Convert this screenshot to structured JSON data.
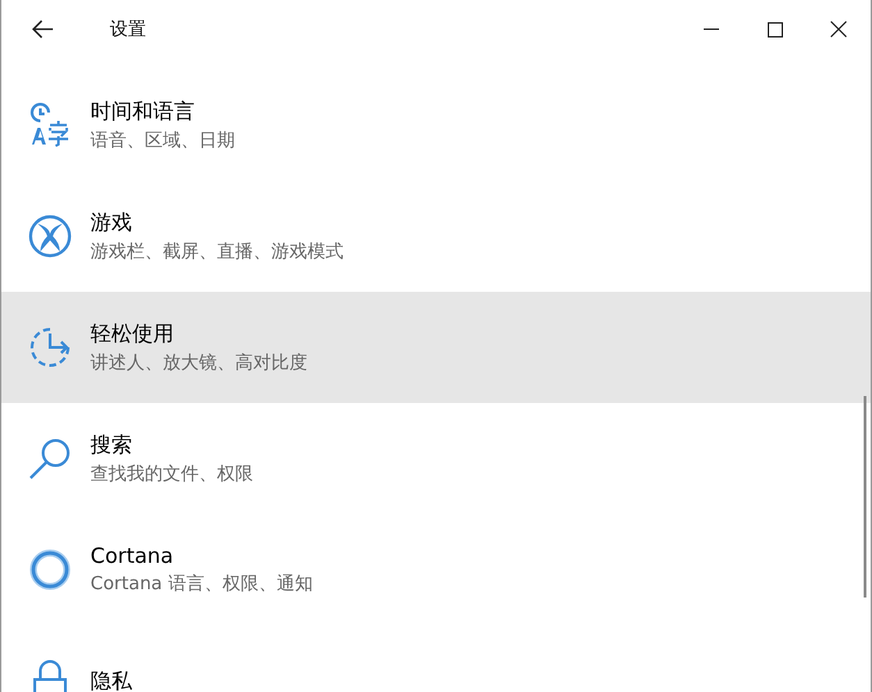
{
  "window": {
    "title": "设置"
  },
  "items": [
    {
      "kind": "time-language",
      "title": "时间和语言",
      "subtitle": "语音、区域、日期",
      "selected": false
    },
    {
      "kind": "gaming",
      "title": "游戏",
      "subtitle": "游戏栏、截屏、直播、游戏模式",
      "selected": false
    },
    {
      "kind": "ease",
      "title": "轻松使用",
      "subtitle": "讲述人、放大镜、高对比度",
      "selected": true
    },
    {
      "kind": "search",
      "title": "搜索",
      "subtitle": "查找我的文件、权限",
      "selected": false
    },
    {
      "kind": "cortana",
      "title": "Cortana",
      "subtitle": "Cortana 语言、权限、通知",
      "selected": false
    },
    {
      "kind": "privacy",
      "title": "隐私",
      "selected": false
    }
  ]
}
